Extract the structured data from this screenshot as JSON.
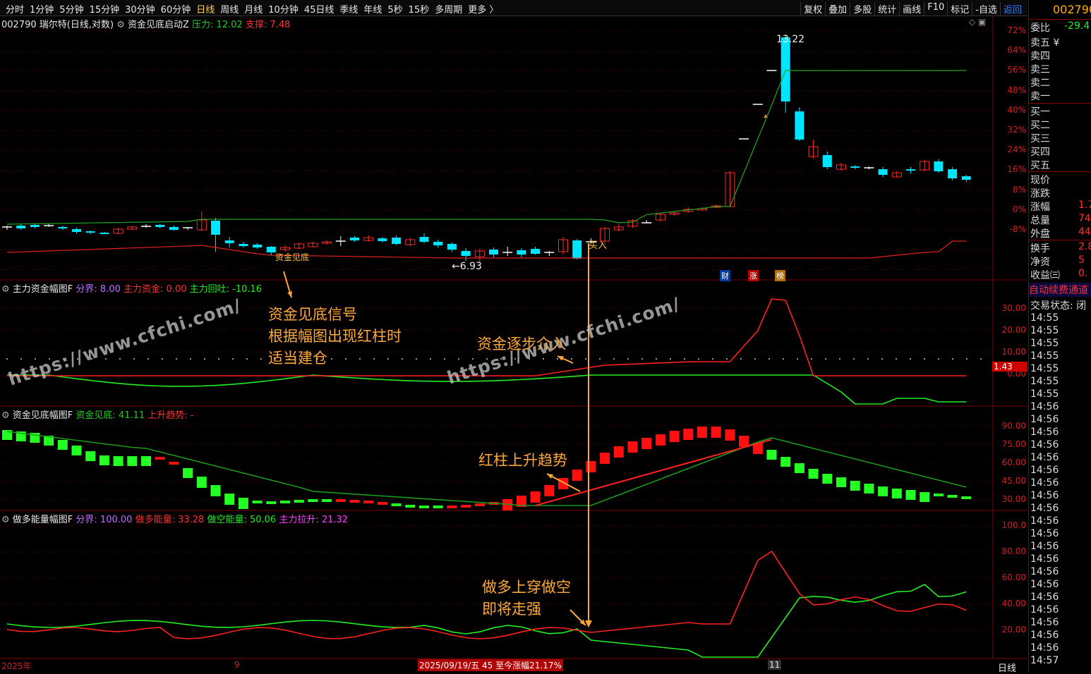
{
  "toolbar": {
    "periods": [
      "分时",
      "1分钟",
      "5分钟",
      "15分钟",
      "30分钟",
      "60分钟",
      "日线",
      "周线",
      "月线",
      "10分钟",
      "45日线",
      "季线",
      "年线",
      "5秒",
      "15秒",
      "多周期",
      "更多 〉"
    ],
    "active_period": "日线",
    "tools": [
      "复权",
      "叠加",
      "多股",
      "统计",
      "画线",
      "F10",
      "标记",
      "-自选",
      "返回"
    ]
  },
  "main_panel": {
    "stock": "002790 瑞尔特(日线,对数)",
    "indicator": "资金见底启动Z",
    "pressure_label": "压力: 12.02",
    "support_label": "支撑: 7.48",
    "high_label": "13.22",
    "low_label": "←6.93",
    "signal_bottom": "资金见底",
    "signal_buy": "买入",
    "event_tags": [
      "财",
      "涨",
      "榜"
    ],
    "y_ticks": [
      "72%",
      "64%",
      "56%",
      "48%",
      "40%",
      "32%",
      "24%",
      "16%",
      "8%",
      "0%",
      "-8%"
    ]
  },
  "panel1": {
    "title": "主力资金幅图F",
    "v1": "分界: 8.00",
    "v2": "主力资金: 0.00",
    "v3": "主力回吐: -10.16",
    "y_ticks": [
      "30.00",
      "20.00",
      "10.00",
      "0.00"
    ],
    "last_value": "1.43"
  },
  "panel2": {
    "title": "资金见底幅图F",
    "v1": "资金见底: 41.11",
    "v2": "上升趋势: -",
    "y_ticks": [
      "90.00",
      "75.00",
      "60.00",
      "45.00",
      "30.00"
    ]
  },
  "panel3": {
    "title": "做多能量幅图F",
    "v1": "分界: 100.00",
    "v2": "做多能量: 33.28",
    "v3": "做空能量: 50.06",
    "v4": "主力拉升: 21.32",
    "y_ticks": [
      "100.0",
      "80.00",
      "60.00",
      "40.00",
      "20.00"
    ]
  },
  "annotations": {
    "a1": [
      "资金见底信号",
      "根据幅图出现红柱时",
      "适当建仓"
    ],
    "a2": "资金逐步介入",
    "a3": "红柱上升趋势",
    "a4": [
      "做多上穿做空",
      "即将走强"
    ]
  },
  "watermarks": [
    "https://www.cfchi.com/",
    "https://www.cfchi.com/"
  ],
  "date_axis": {
    "left": "2025年",
    "mid": "9",
    "cursor": "2025/09/19/五 45 至今涨幅21.17%",
    "right": "11",
    "mode": "日线"
  },
  "right_panel": {
    "code": "002790",
    "weibi_label": "委比",
    "weibi_value": "-29.4",
    "asks": [
      "卖五 ¥",
      "卖四",
      "卖三",
      "卖二",
      "卖一"
    ],
    "bids": [
      "买一",
      "买二",
      "买三",
      "买四",
      "买五"
    ],
    "stats": [
      "现价",
      "涨跌",
      "涨幅",
      "总量",
      "外盘"
    ],
    "stat_values": [
      "",
      "",
      "1.7",
      "74",
      "44"
    ],
    "stats2": [
      "换手",
      "净资",
      "收益㈢"
    ],
    "stat2_values": [
      "2.8",
      "5",
      "0."
    ],
    "banner": "自动续费通道",
    "trade_state": "交易状态: 闭",
    "ticks": [
      "14:55",
      "14:55",
      "14:55",
      "14:55",
      "14:55",
      "14:55",
      "14:55",
      "14:56",
      "14:56",
      "14:56",
      "14:56",
      "14:56",
      "14:56",
      "14:56",
      "14:56",
      "14:56",
      "14:56",
      "14:56",
      "14:56",
      "14:56",
      "14:56",
      "14:56",
      "14:56",
      "14:56",
      "14:56",
      "14:56",
      "14:56",
      "14:57"
    ]
  },
  "colors": {
    "up": "#ff2a2a",
    "down": "#00e5ff",
    "green": "#23ff23",
    "note": "#ffa83a"
  }
}
